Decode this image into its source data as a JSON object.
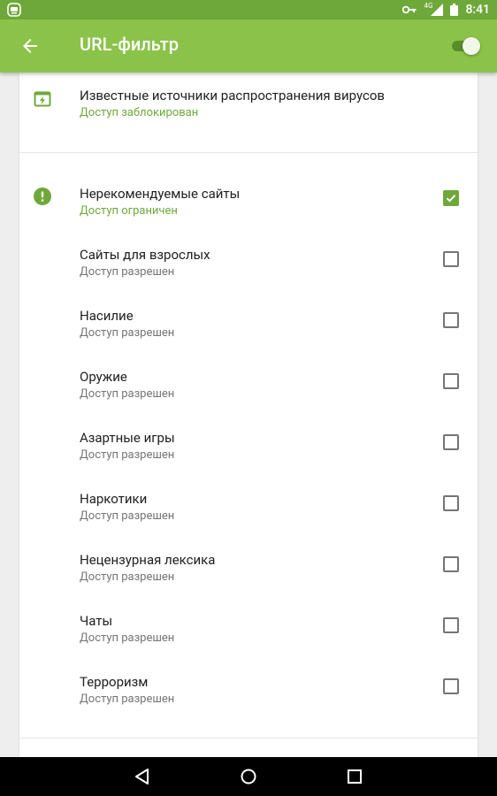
{
  "status_bar": {
    "time": "8:41",
    "network": "4G",
    "icons": [
      "app-notification-icon",
      "key-icon",
      "signal-icon",
      "battery-icon"
    ]
  },
  "app_bar": {
    "title": "URL-фильтр",
    "back_icon": "arrow-back-icon",
    "toggle_state": "on"
  },
  "colors": {
    "primary": "#8bc34a",
    "primary_dark": "#6fa83a",
    "text_primary": "#212121",
    "text_secondary": "#757575"
  },
  "top_item": {
    "icon": "browser-bolt-icon",
    "label": "Известные источники распространения вирусов",
    "status": "Доступ заблокирован"
  },
  "categories": [
    {
      "label": "Нерекомендуемые сайты",
      "status": "Доступ ограничен",
      "checked": true,
      "icon": "warning-icon"
    },
    {
      "label": "Сайты для взрослых",
      "status": "Доступ разрешен",
      "checked": false
    },
    {
      "label": "Насилие",
      "status": "Доступ разрешен",
      "checked": false
    },
    {
      "label": "Оружие",
      "status": "Доступ разрешен",
      "checked": false
    },
    {
      "label": "Азартные игры",
      "status": "Доступ разрешен",
      "checked": false
    },
    {
      "label": "Наркотики",
      "status": "Доступ разрешен",
      "checked": false
    },
    {
      "label": "Нецензурная лексика",
      "status": "Доступ разрешен",
      "checked": false
    },
    {
      "label": "Чаты",
      "status": "Доступ разрешен",
      "checked": false
    },
    {
      "label": "Терроризм",
      "status": "Доступ разрешен",
      "checked": false
    }
  ],
  "nav_bar": {
    "buttons": [
      "back-triangle-icon",
      "home-circle-icon",
      "recents-square-icon"
    ]
  }
}
